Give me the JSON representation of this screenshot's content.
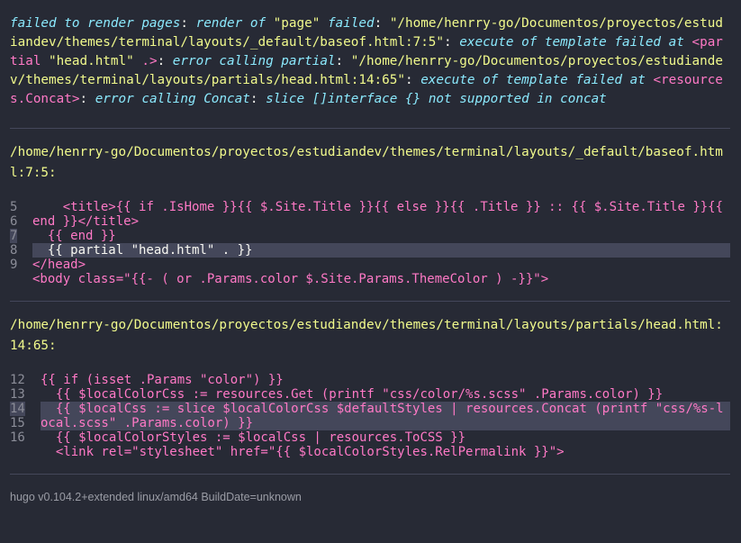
{
  "error_message": {
    "line1_a": "failed to render pages",
    "line1_b": "render of",
    "line1_c": "\"page\"",
    "line1_d": "failed",
    "line1_e": "\"/home/henrry-go/Documentos/proyectos/estudiandev/themes/terminal/layouts/_default/baseof.html:7:5\"",
    "line1_f": "execute of template failed at",
    "line1_g": "<partial",
    "line1_h": "\"head.html\"",
    "line1_i": ".>",
    "line1_j": "error calling partial",
    "line1_k": "\"/home/henrry-go/Documentos/proyectos/estudiandev/themes/terminal/layouts/partials/head.html:14:65\"",
    "line1_l": "execute of template failed at",
    "line1_m": "<resources.Concat>",
    "line1_n": "error calling Concat",
    "line1_o": "slice []interface {} not supported in concat"
  },
  "block1": {
    "path": "/home/henrry-go/Documentos/proyectos/estudiandev/themes/terminal/layouts/_default/baseof.html:7:5:",
    "gutter": [
      "5",
      "6",
      "7",
      "8",
      "9"
    ],
    "l5_indent": "    ",
    "l5_tag_open": "<title>",
    "l5_tpl": "{{ if .IsHome }}{{ $.Site.Title }}{{ else }}{{ .Title }} :: {{ $.Site.Title }}{{ end }}",
    "l5_tag_close": "</title>",
    "l6": "  {{ end }}",
    "l7": "  {{ partial \"head.html\" . }}",
    "l8_tag": "</head>",
    "l9_body": "<body class=\"{{- ( or .Params.color $.Site.Params.ThemeColor ) -}}\">"
  },
  "block2": {
    "path": "/home/henrry-go/Documentos/proyectos/estudiandev/themes/terminal/layouts/partials/head.html:14:65:",
    "gutter": [
      "12",
      "13",
      "14",
      "15",
      "16"
    ],
    "l12": "{{ if (isset .Params \"color\") }}",
    "l13": "  {{ $localColorCss := resources.Get (printf \"css/color/%s.scss\" .Params.color) }}",
    "l14": "  {{ $localCss := slice $localColorCss $defaultStyles | resources.Concat (printf \"css/%s-local.scss\" .Params.color) }}",
    "l15": "  {{ $localColorStyles := $localCss | resources.ToCSS }}",
    "l16": "  <link rel=\"stylesheet\" href=\"{{ $localColorStyles.RelPermalink }}\">"
  },
  "footer": {
    "version": "hugo v0.104.2+extended linux/amd64 BuildDate=unknown"
  },
  "colors": {
    "background": "#272a35",
    "keyword": "#ff79c6",
    "string": "#f1fa8c",
    "italic": "#8be9fd",
    "highlight": "#44475a"
  }
}
